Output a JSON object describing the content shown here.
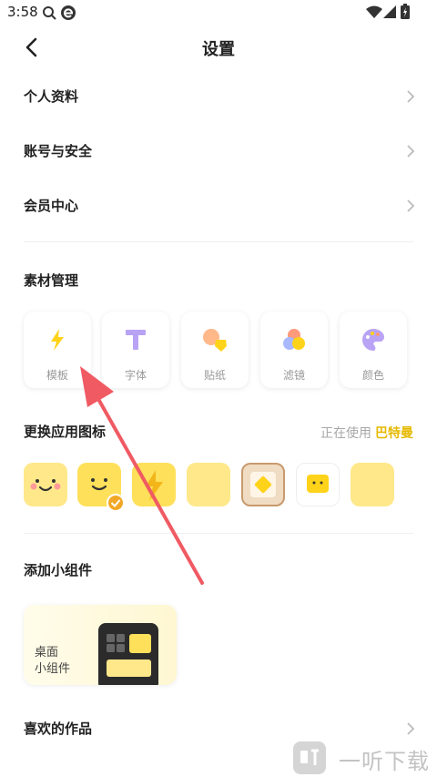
{
  "status_bar": {
    "time": "3:58"
  },
  "header": {
    "title": "设置"
  },
  "settings": [
    {
      "label": "个人资料"
    },
    {
      "label": "账号与安全"
    },
    {
      "label": "会员中心"
    }
  ],
  "materials": {
    "title": "素材管理",
    "items": [
      {
        "label": "模板",
        "icon": "lightning-icon"
      },
      {
        "label": "字体",
        "icon": "font-t-icon"
      },
      {
        "label": "贴纸",
        "icon": "sticker-icon"
      },
      {
        "label": "滤镜",
        "icon": "filter-icon"
      },
      {
        "label": "颜色",
        "icon": "palette-icon"
      }
    ]
  },
  "app_icon": {
    "title": "更换应用图标",
    "using_label": "正在使用",
    "using_value": "巴特曼",
    "selected_index": 1
  },
  "widget": {
    "title": "添加小组件",
    "line1": "桌面",
    "line2": "小组件"
  },
  "favorites": {
    "label": "喜欢的作品"
  },
  "watermark": {
    "text": "一听下载"
  },
  "colors": {
    "accent": "#e5b900",
    "arrow": "#f05a63",
    "icon_yellow": "#ffe88a"
  }
}
